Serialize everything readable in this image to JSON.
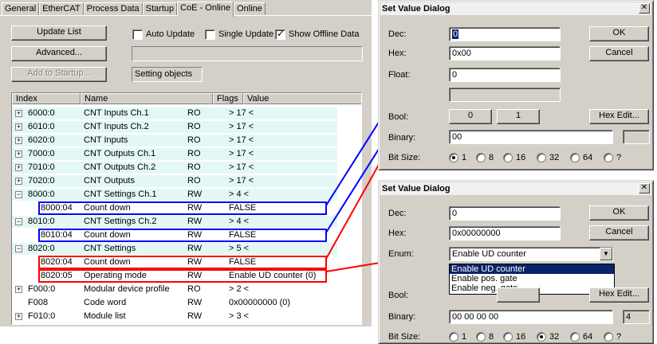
{
  "tabs": [
    "General",
    "EtherCAT",
    "Process Data",
    "Startup",
    "CoE - Online",
    "Online"
  ],
  "active_tab": "CoE - Online",
  "buttons": {
    "update_list": "Update List",
    "advanced": "Advanced...",
    "add_to_startup": "Add to Startup..."
  },
  "options": {
    "auto_update": {
      "label": "Auto Update",
      "checked": false
    },
    "single_update": {
      "label": "Single Update",
      "checked": false
    },
    "show_offline": {
      "label": "Show Offline Data",
      "checked": true
    }
  },
  "status_box": "Setting objects",
  "table": {
    "headers": [
      "Index",
      "Name",
      "Flags",
      "Value"
    ],
    "rows": [
      {
        "pm": "+",
        "index": "6000:0",
        "name": "CNT Inputs Ch.1",
        "flags": "RO",
        "value": "> 17 <",
        "shaded": true
      },
      {
        "pm": "+",
        "index": "6010:0",
        "name": "CNT Inputs Ch.2",
        "flags": "RO",
        "value": "> 17 <",
        "shaded": true
      },
      {
        "pm": "+",
        "index": "6020:0",
        "name": "CNT Inputs",
        "flags": "RO",
        "value": "> 17 <",
        "shaded": true
      },
      {
        "pm": "+",
        "index": "7000:0",
        "name": "CNT Outputs Ch.1",
        "flags": "RO",
        "value": "> 17 <",
        "shaded": true
      },
      {
        "pm": "+",
        "index": "7010:0",
        "name": "CNT Outputs Ch.2",
        "flags": "RO",
        "value": "> 17 <",
        "shaded": true
      },
      {
        "pm": "+",
        "index": "7020:0",
        "name": "CNT Outputs",
        "flags": "RO",
        "value": "> 17 <",
        "shaded": true
      },
      {
        "pm": "−",
        "index": "8000:0",
        "name": "CNT Settings Ch.1",
        "flags": "RW",
        "value": "> 4 <",
        "shaded": true
      },
      {
        "pm": "",
        "index": "8000:04",
        "name": "Count down",
        "flags": "RW",
        "value": "FALSE",
        "shaded": false,
        "hl": "blue",
        "child": true
      },
      {
        "pm": "−",
        "index": "8010:0",
        "name": "CNT Settings Ch.2",
        "flags": "RW",
        "value": "> 4 <",
        "shaded": true
      },
      {
        "pm": "",
        "index": "8010:04",
        "name": "Count down",
        "flags": "RW",
        "value": "FALSE",
        "shaded": false,
        "hl": "blue",
        "child": true
      },
      {
        "pm": "−",
        "index": "8020:0",
        "name": "CNT Settings",
        "flags": "RW",
        "value": "> 5 <",
        "shaded": true
      },
      {
        "pm": "",
        "index": "8020:04",
        "name": "Count down",
        "flags": "RW",
        "value": "FALSE",
        "shaded": false,
        "hl": "red",
        "child": true
      },
      {
        "pm": "",
        "index": "8020:05",
        "name": "Operating mode",
        "flags": "RW",
        "value": "Enable UD counter (0)",
        "shaded": false,
        "hl": "red",
        "child": true
      },
      {
        "pm": "+",
        "index": "F000:0",
        "name": "Modular device profile",
        "flags": "RO",
        "value": "> 2 <",
        "shaded": false
      },
      {
        "pm": "",
        "index": "F008",
        "name": "Code word",
        "flags": "RW",
        "value": "0x00000000 (0)",
        "shaded": false
      },
      {
        "pm": "+",
        "index": "F010:0",
        "name": "Module list",
        "flags": "RW",
        "value": "> 3 <",
        "shaded": false
      }
    ]
  },
  "dialog1": {
    "title": "Set Value Dialog",
    "close": "✕",
    "dec_label": "Dec:",
    "dec_value": "0",
    "hex_label": "Hex:",
    "hex_value": "0x00",
    "float_label": "Float:",
    "float_value": "0",
    "bool_label": "Bool:",
    "bool_0": "0",
    "bool_1": "1",
    "binary_label": "Binary:",
    "binary_value": "00",
    "bitsize_label": "Bit Size:",
    "bitsize_options": [
      "1",
      "8",
      "16",
      "32",
      "64",
      "?"
    ],
    "bitsize_selected": "1",
    "ok": "OK",
    "cancel": "Cancel",
    "hex_edit": "Hex Edit..."
  },
  "dialog2": {
    "title": "Set Value Dialog",
    "close": "✕",
    "dec_label": "Dec:",
    "dec_value": "0",
    "hex_label": "Hex:",
    "hex_value": "0x00000000",
    "enum_label": "Enum:",
    "enum_value": "Enable UD counter",
    "enum_options": [
      "Enable UD counter",
      "Enable pos. gate",
      "Enable neg. gate"
    ],
    "bool_label": "Bool:",
    "binary_label": "Binary:",
    "binary_value": "00 00 00 00",
    "binary_len": "4",
    "bitsize_label": "Bit Size:",
    "bitsize_options": [
      "1",
      "8",
      "16",
      "32",
      "64",
      "?"
    ],
    "bitsize_selected": "32",
    "ok": "OK",
    "cancel": "Cancel",
    "hex_edit": "Hex Edit..."
  },
  "colors": {
    "blue_highlight": "#0000ff",
    "red_highlight": "#ff0000",
    "shaded_row": "#e4f7f7",
    "window_face": "#d4d0c8"
  }
}
